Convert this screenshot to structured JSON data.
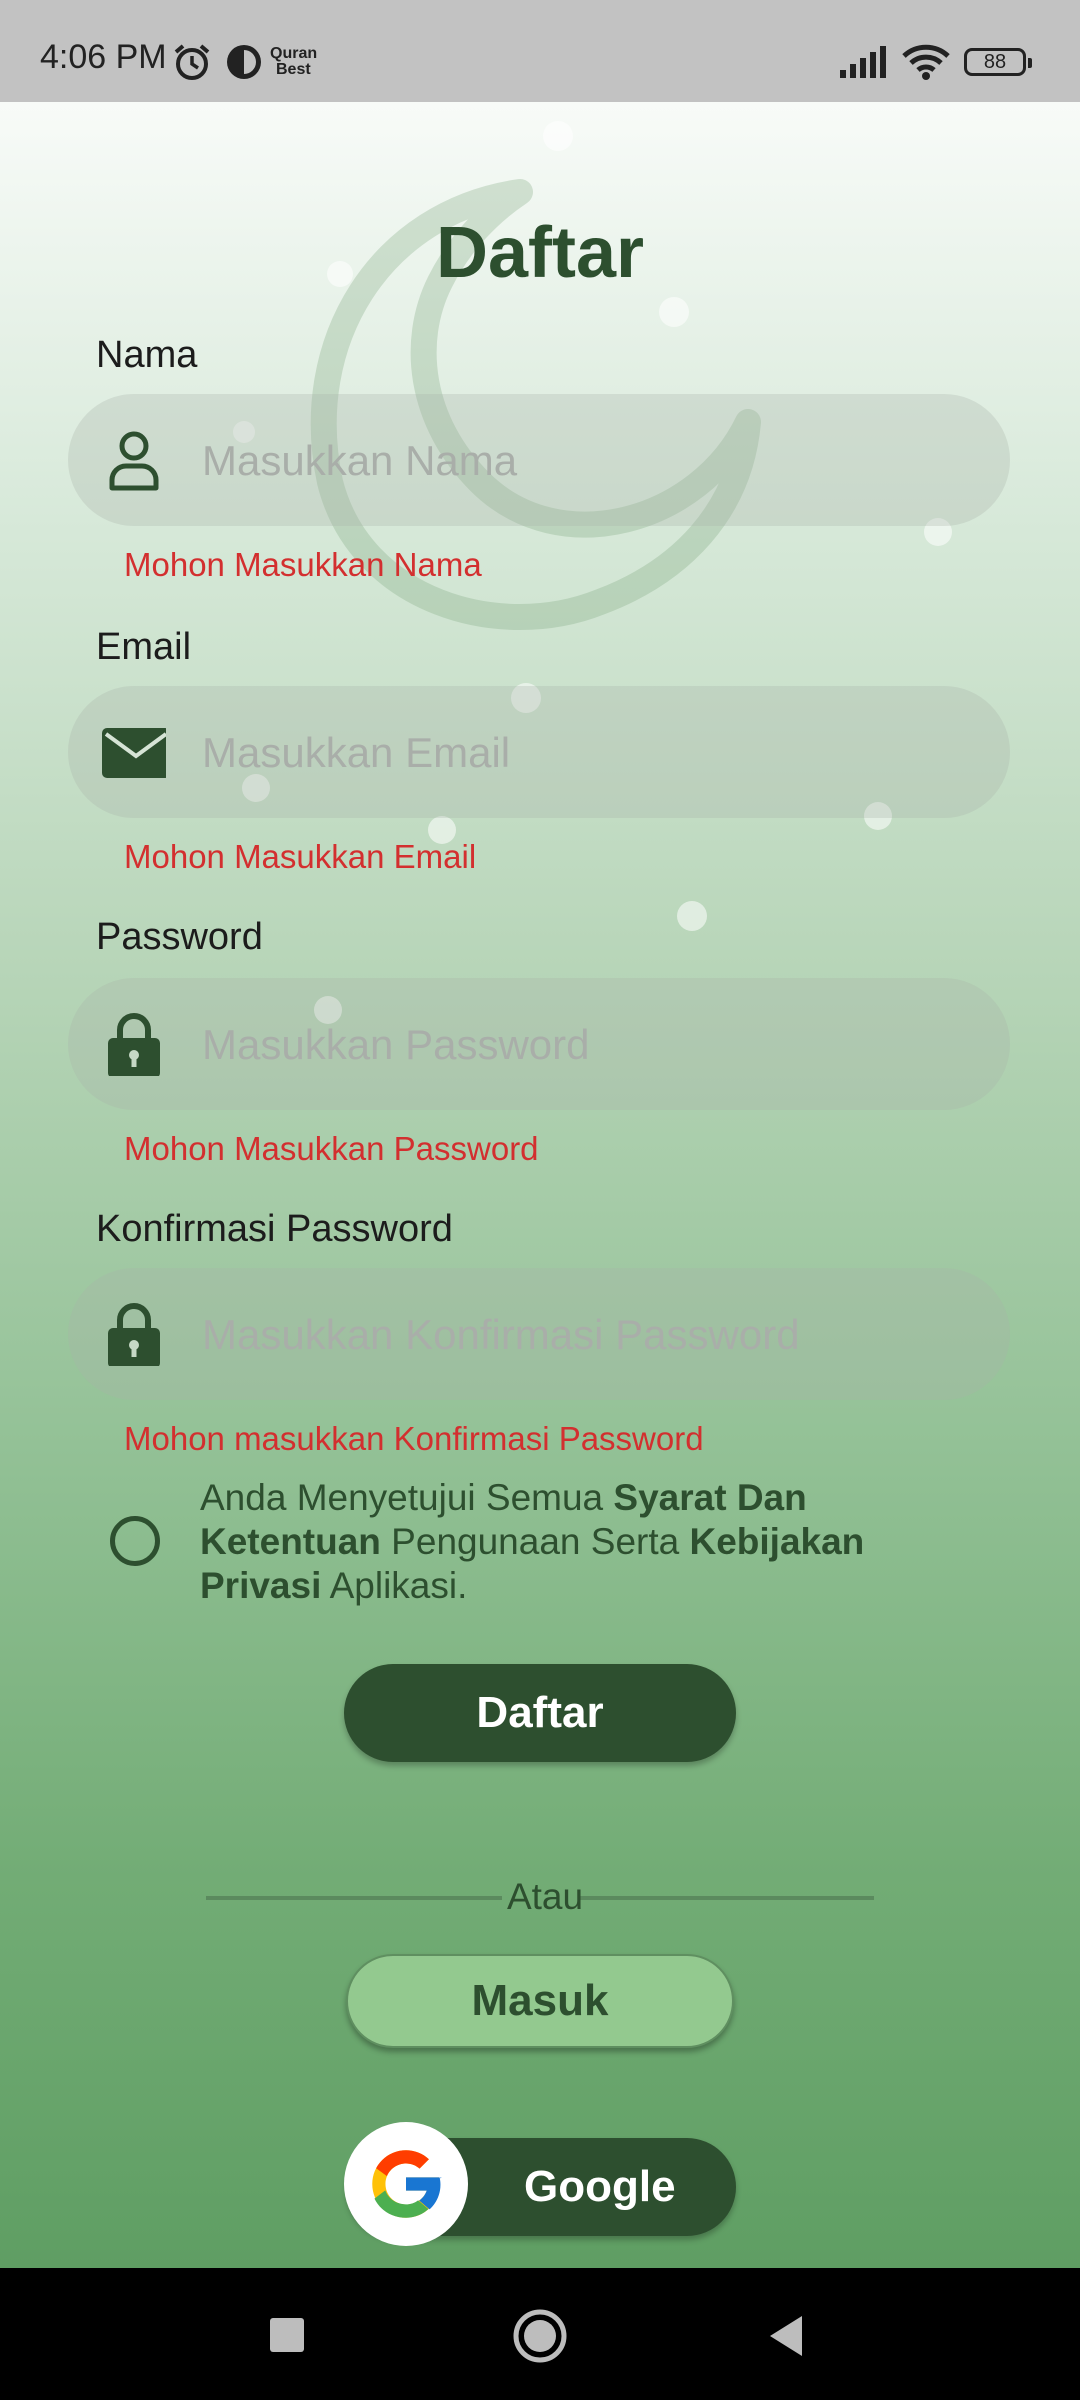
{
  "status_bar": {
    "time": "4:06 PM",
    "app_badge": [
      "Quran",
      "Best"
    ],
    "battery": "88",
    "icons": [
      "alarm-icon",
      "app-notification-icon",
      "signal-icon",
      "wifi-icon",
      "battery-icon"
    ]
  },
  "form": {
    "title": "Daftar",
    "fields": [
      {
        "label": "Nama",
        "placeholder": "Masukkan Nama",
        "value": "",
        "error": "Mohon Masukkan Nama",
        "icon": "person-icon"
      },
      {
        "label": "Email",
        "placeholder": "Masukkan Email",
        "value": "",
        "error": "Mohon Masukkan Email",
        "icon": "mail-icon"
      },
      {
        "label": "Password",
        "placeholder": "Masukkan Password",
        "value": "",
        "error": "Mohon Masukkan Password",
        "icon": "lock-icon"
      },
      {
        "label": "Konfirmasi Password",
        "placeholder": "Masukkan Konfirmasi Password",
        "value": "",
        "error": "Mohon masukkan Konfirmasi Password",
        "icon": "lock-icon"
      }
    ],
    "terms": {
      "p1": "Anda Menyetujui Semua ",
      "b1": "Syarat Dan Ketentuan",
      "p2": " Pengunaan Serta ",
      "b2": "Kebijakan Privasi",
      "p3": " Aplikasi.",
      "checked": false
    },
    "submit_label": "Daftar",
    "divider_text": "Atau",
    "login_label": "Masuk",
    "google_label": "Google"
  },
  "colors": {
    "primary": "#2d4f2f",
    "error": "#d32f2f",
    "light_green_button": "#93c98f"
  },
  "nav_bar": {
    "icons": [
      "recents-square-icon",
      "home-circle-icon",
      "back-triangle-icon"
    ]
  }
}
